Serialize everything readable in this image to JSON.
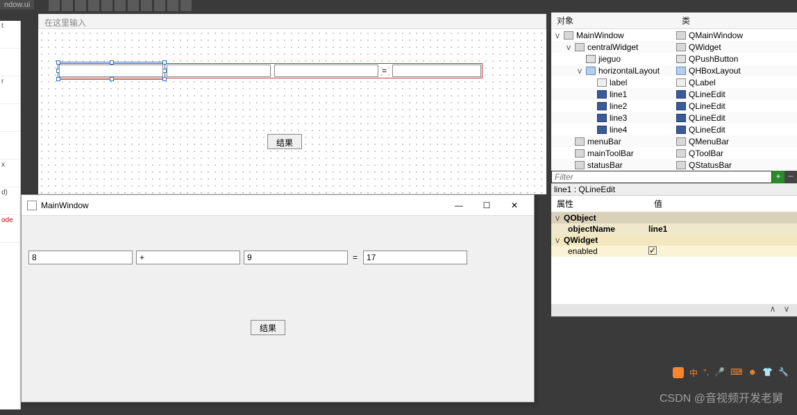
{
  "tab_title": "ndow.ui",
  "designer": {
    "placeholder": "在这里输入",
    "button_label": "结果",
    "equals": "="
  },
  "runtime": {
    "title": "MainWindow",
    "line1": "8",
    "line2": "+",
    "line3": "9",
    "equals": "=",
    "line4": "17",
    "button_label": "结果"
  },
  "inspector": {
    "col_object": "对象",
    "col_class": "类",
    "rows": [
      {
        "depth": 0,
        "expand": "v",
        "name": "MainWindow",
        "icon": "form",
        "cls": "QMainWindow"
      },
      {
        "depth": 1,
        "expand": "v",
        "name": "centralWidget",
        "icon": "form",
        "cls": "QWidget"
      },
      {
        "depth": 2,
        "expand": "",
        "name": "jieguo",
        "icon": "push",
        "cls": "QPushButton"
      },
      {
        "depth": 2,
        "expand": "v",
        "name": "horizontalLayout",
        "icon": "layout",
        "cls": "QHBoxLayout"
      },
      {
        "depth": 3,
        "expand": "",
        "name": "label",
        "icon": "label",
        "cls": "QLabel"
      },
      {
        "depth": 3,
        "expand": "",
        "name": "line1",
        "icon": "edit",
        "cls": "QLineEdit"
      },
      {
        "depth": 3,
        "expand": "",
        "name": "line2",
        "icon": "edit",
        "cls": "QLineEdit"
      },
      {
        "depth": 3,
        "expand": "",
        "name": "line3",
        "icon": "edit",
        "cls": "QLineEdit"
      },
      {
        "depth": 3,
        "expand": "",
        "name": "line4",
        "icon": "edit",
        "cls": "QLineEdit"
      },
      {
        "depth": 1,
        "expand": "",
        "name": "menuBar",
        "icon": "form",
        "cls": "QMenuBar"
      },
      {
        "depth": 1,
        "expand": "",
        "name": "mainToolBar",
        "icon": "form",
        "cls": "QToolBar"
      },
      {
        "depth": 1,
        "expand": "",
        "name": "statusBar",
        "icon": "form",
        "cls": "QStatusBar"
      }
    ]
  },
  "filter_placeholder": "Filter",
  "selected_obj": "line1 : QLineEdit",
  "props": {
    "col_prop": "属性",
    "col_val": "值",
    "sec_qobject": "QObject",
    "objectName_key": "objectName",
    "objectName_val": "line1",
    "sec_qwidget": "QWidget",
    "enabled_key": "enabled",
    "enabled_checked": "✓"
  },
  "ime": {
    "text": "中"
  },
  "watermark": "CSDN @音视频开发老舅"
}
